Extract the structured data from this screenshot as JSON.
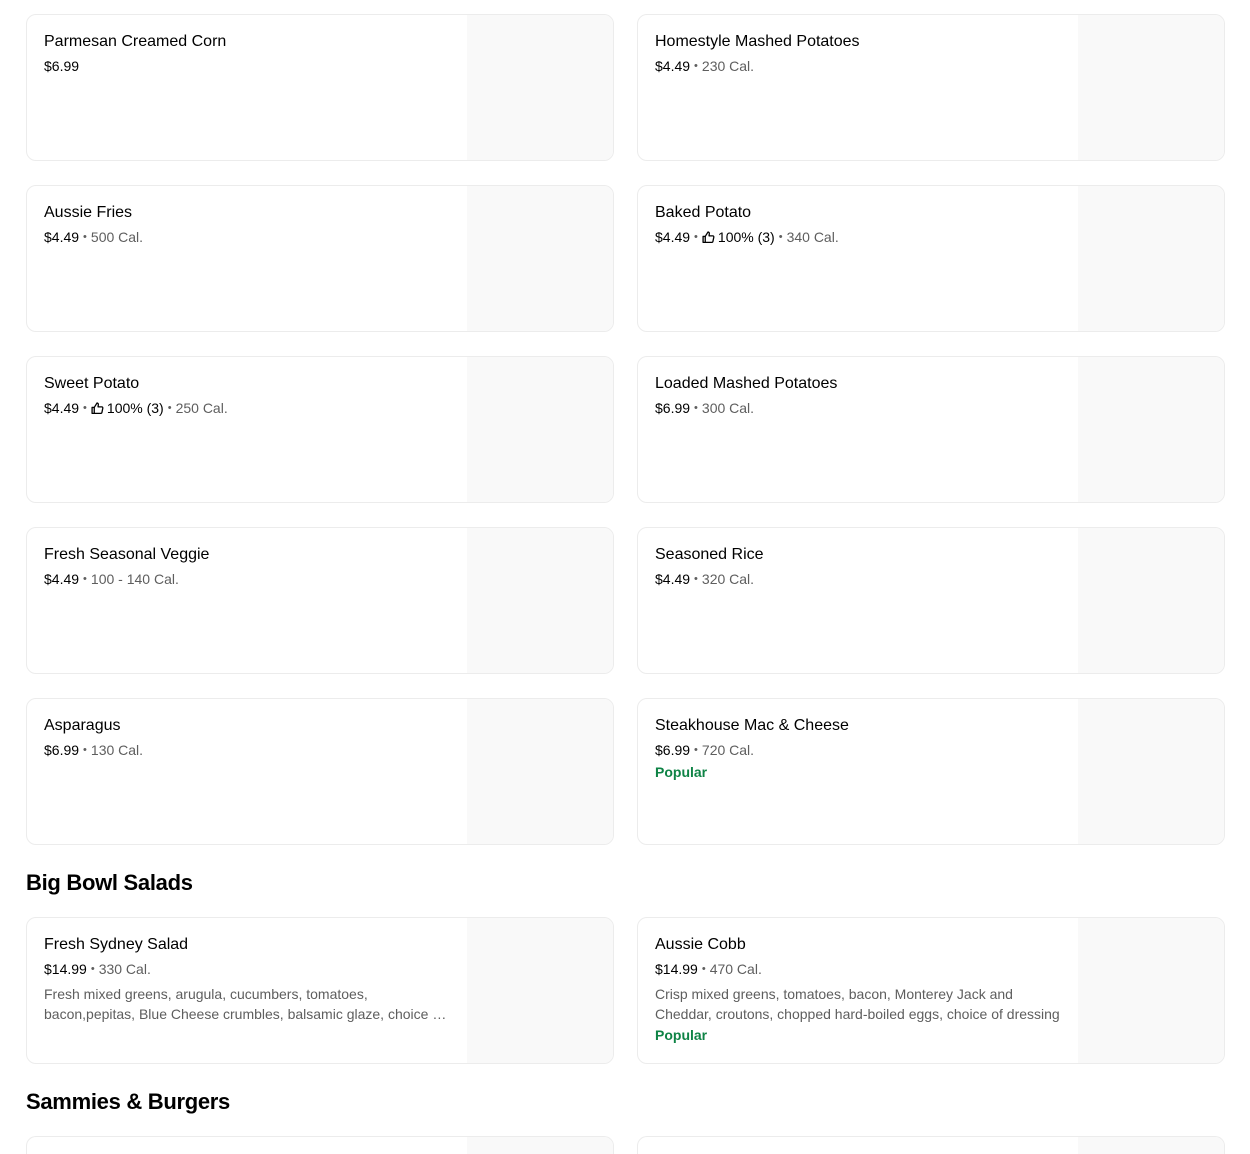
{
  "sides": [
    {
      "name": "Parmesan Creamed Corn",
      "price": "$6.99",
      "rating": "",
      "calories": ""
    },
    {
      "name": "Homestyle Mashed Potatoes",
      "price": "$4.49",
      "rating": "",
      "calories": "230 Cal."
    },
    {
      "name": "Aussie Fries",
      "price": "$4.49",
      "rating": "",
      "calories": "500 Cal."
    },
    {
      "name": "Baked Potato",
      "price": "$4.49",
      "rating": "100% (3)",
      "calories": "340 Cal."
    },
    {
      "name": "Sweet Potato",
      "price": "$4.49",
      "rating": "100% (3)",
      "calories": "250 Cal."
    },
    {
      "name": "Loaded Mashed Potatoes",
      "price": "$6.99",
      "rating": "",
      "calories": "300 Cal."
    },
    {
      "name": "Fresh Seasonal Veggie",
      "price": "$4.49",
      "rating": "",
      "calories": "100 - 140 Cal."
    },
    {
      "name": "Seasoned Rice",
      "price": "$4.49",
      "rating": "",
      "calories": "320 Cal."
    },
    {
      "name": "Asparagus",
      "price": "$6.99",
      "rating": "",
      "calories": "130 Cal."
    },
    {
      "name": "Steakhouse Mac & Cheese",
      "price": "$6.99",
      "rating": "",
      "calories": "720 Cal.",
      "badge": "Popular"
    }
  ],
  "salads_section": {
    "title": "Big Bowl Salads",
    "items": [
      {
        "name": "Fresh Sydney Salad",
        "price": "$14.99",
        "calories": "330 Cal.",
        "description": "Fresh mixed greens, arugula, cucumbers, tomatoes, bacon,pepitas, Blue Cheese crumbles, balsamic glaze, choice of dressing"
      },
      {
        "name": "Aussie Cobb",
        "price": "$14.99",
        "calories": "470 Cal.",
        "description": "Crisp mixed greens, tomatoes, bacon, Monterey Jack and Cheddar, croutons, chopped hard-boiled eggs, choice of dressing",
        "badge": "Popular"
      }
    ]
  },
  "sammies_section": {
    "title": "Sammies & Burgers"
  },
  "icons": {
    "rating": "thumbs-up-icon"
  },
  "colors": {
    "popular": "#0e8345",
    "muted": "#5e5e5e",
    "image_placeholder": "#f9f9f9"
  }
}
